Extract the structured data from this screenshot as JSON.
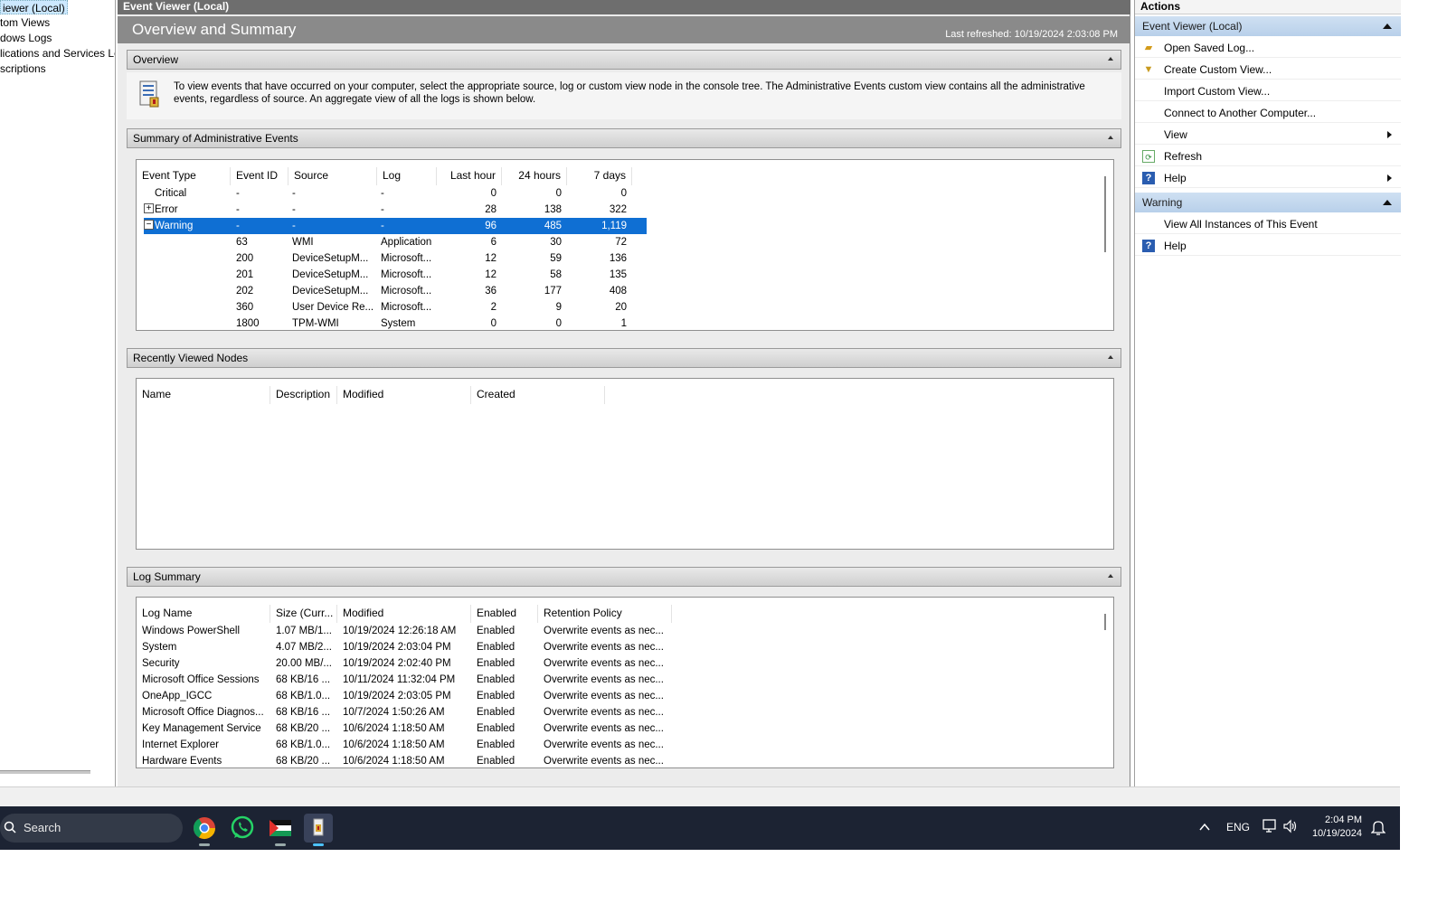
{
  "tree": {
    "items": [
      "iewer (Local)",
      "tom Views",
      "dows Logs",
      "lications and Services Lo",
      "scriptions"
    ]
  },
  "mid": {
    "top_title": "Event Viewer (Local)",
    "banner_title": "Overview and Summary",
    "last_refreshed": "Last refreshed: 10/19/2024 2:03:08 PM",
    "overview": {
      "header": "Overview",
      "text": "To view events that have occurred on your computer, select the appropriate source, log or custom view node in the console tree. The Administrative Events custom view contains all the administrative events, regardless of source. An aggregate view of all the logs is shown below."
    },
    "summary": {
      "header": "Summary of Administrative Events",
      "columns": [
        "Event Type",
        "Event ID",
        "Source",
        "Log",
        "Last hour",
        "24 hours",
        "7 days"
      ],
      "rows": [
        {
          "type": "Critical",
          "id": "-",
          "source": "-",
          "log": "-",
          "h": "0",
          "d": "0",
          "w": "0"
        },
        {
          "type": "Error",
          "id": "-",
          "source": "-",
          "log": "-",
          "h": "28",
          "d": "138",
          "w": "322"
        },
        {
          "type": "Warning",
          "id": "-",
          "source": "-",
          "log": "-",
          "h": "96",
          "d": "485",
          "w": "1,119"
        },
        {
          "type": "",
          "id": "63",
          "source": "WMI",
          "log": "Application",
          "h": "6",
          "d": "30",
          "w": "72"
        },
        {
          "type": "",
          "id": "200",
          "source": "DeviceSetupM...",
          "log": "Microsoft...",
          "h": "12",
          "d": "59",
          "w": "136"
        },
        {
          "type": "",
          "id": "201",
          "source": "DeviceSetupM...",
          "log": "Microsoft...",
          "h": "12",
          "d": "58",
          "w": "135"
        },
        {
          "type": "",
          "id": "202",
          "source": "DeviceSetupM...",
          "log": "Microsoft...",
          "h": "36",
          "d": "177",
          "w": "408"
        },
        {
          "type": "",
          "id": "360",
          "source": "User Device Re...",
          "log": "Microsoft...",
          "h": "2",
          "d": "9",
          "w": "20"
        },
        {
          "type": "",
          "id": "1800",
          "source": "TPM-WMI",
          "log": "System",
          "h": "0",
          "d": "0",
          "w": "1"
        }
      ]
    },
    "recent": {
      "header": "Recently Viewed Nodes",
      "columns": [
        "Name",
        "Description",
        "Modified",
        "Created"
      ]
    },
    "logsum": {
      "header": "Log Summary",
      "columns": [
        "Log Name",
        "Size (Curr...",
        "Modified",
        "Enabled",
        "Retention Policy"
      ],
      "rows": [
        {
          "name": "Windows PowerShell",
          "size": "1.07 MB/1...",
          "mod": "10/19/2024 12:26:18 AM",
          "en": "Enabled",
          "ret": "Overwrite events as nec..."
        },
        {
          "name": "System",
          "size": "4.07 MB/2...",
          "mod": "10/19/2024 2:03:04 PM",
          "en": "Enabled",
          "ret": "Overwrite events as nec..."
        },
        {
          "name": "Security",
          "size": "20.00 MB/...",
          "mod": "10/19/2024 2:02:40 PM",
          "en": "Enabled",
          "ret": "Overwrite events as nec..."
        },
        {
          "name": "Microsoft Office Sessions",
          "size": "68 KB/16 ...",
          "mod": "10/11/2024 11:32:04 PM",
          "en": "Enabled",
          "ret": "Overwrite events as nec..."
        },
        {
          "name": "OneApp_IGCC",
          "size": "68 KB/1.0...",
          "mod": "10/19/2024 2:03:05 PM",
          "en": "Enabled",
          "ret": "Overwrite events as nec..."
        },
        {
          "name": "Microsoft Office Diagnos...",
          "size": "68 KB/16 ...",
          "mod": "10/7/2024 1:50:26 AM",
          "en": "Enabled",
          "ret": "Overwrite events as nec..."
        },
        {
          "name": "Key Management Service",
          "size": "68 KB/20 ...",
          "mod": "10/6/2024 1:18:50 AM",
          "en": "Enabled",
          "ret": "Overwrite events as nec..."
        },
        {
          "name": "Internet Explorer",
          "size": "68 KB/1.0...",
          "mod": "10/6/2024 1:18:50 AM",
          "en": "Enabled",
          "ret": "Overwrite events as nec..."
        },
        {
          "name": "Hardware Events",
          "size": "68 KB/20 ...",
          "mod": "10/6/2024 1:18:50 AM",
          "en": "Enabled",
          "ret": "Overwrite events as nec..."
        }
      ]
    }
  },
  "actions": {
    "title": "Actions",
    "group1": "Event Viewer (Local)",
    "items1": [
      "Open Saved Log...",
      "Create Custom View...",
      "Import Custom View...",
      "Connect to Another Computer...",
      "View",
      "Refresh",
      "Help"
    ],
    "group2": "Warning",
    "items2": [
      "View All Instances of This Event",
      "Help"
    ]
  },
  "taskbar": {
    "search": "Search",
    "lang": "ENG",
    "time": "2:04 PM",
    "date": "10/19/2024"
  },
  "colors": {
    "selection": "#0f6fd3",
    "taskbar": "#1c2333",
    "actions_group": "#c4d8ee"
  }
}
